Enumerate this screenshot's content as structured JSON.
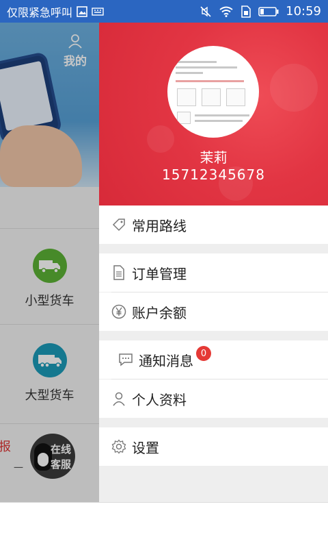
{
  "statusbar": {
    "carrier": "仅限紧急呼叫",
    "time": "10:59",
    "icons": [
      "image-icon",
      "keyboard-icon",
      "mute-icon",
      "wifi-icon",
      "sim-icon",
      "battery-icon"
    ]
  },
  "left_page": {
    "mine_label": "我的",
    "vehicles": [
      {
        "label": "小型货车",
        "color": "#5cb135"
      },
      {
        "label": "大型货车",
        "color": "#1c9ab8"
      }
    ],
    "report_partial": "报",
    "report_partial2": "一",
    "service_label": "在线客服"
  },
  "drawer": {
    "username": "茉莉",
    "phone": "15712345678",
    "menu": [
      {
        "key": "routes",
        "label": "常用路线",
        "icon": "tag-icon"
      },
      {
        "key": "orders",
        "label": "订单管理",
        "icon": "document-icon"
      },
      {
        "key": "balance",
        "label": "账户余额",
        "icon": "yen-icon"
      },
      {
        "key": "notifications",
        "label": "通知消息",
        "icon": "message-icon",
        "badge": "0"
      },
      {
        "key": "profile",
        "label": "个人资料",
        "icon": "person-icon"
      },
      {
        "key": "settings",
        "label": "设置",
        "icon": "gear-icon"
      }
    ]
  },
  "colors": {
    "statusbar": "#2b66c1",
    "drawer_header": "#e23543",
    "badge": "#e53935"
  }
}
